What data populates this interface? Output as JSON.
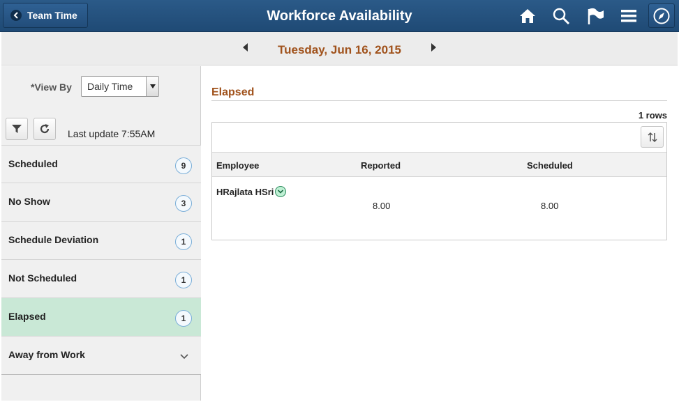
{
  "header": {
    "back_label": "Team Time",
    "title": "Workforce Availability",
    "icons": [
      "home-icon",
      "search-icon",
      "flag-icon",
      "menu-icon",
      "navbar-icon"
    ]
  },
  "datebar": {
    "date": "Tuesday, Jun 16, 2015"
  },
  "sidebar": {
    "view_by_label": "*View By",
    "view_by_value": "Daily Time",
    "last_update": "Last update 7:55AM",
    "items": [
      {
        "label": "Scheduled",
        "count": "9"
      },
      {
        "label": "No Show",
        "count": "3"
      },
      {
        "label": "Schedule Deviation",
        "count": "1"
      },
      {
        "label": "Not Scheduled",
        "count": "1"
      },
      {
        "label": "Elapsed",
        "count": "1",
        "selected": true
      },
      {
        "label": "Away from Work",
        "count": ""
      }
    ]
  },
  "main": {
    "section_title": "Elapsed",
    "rows_count": "1 rows",
    "columns": [
      "Employee",
      "Reported",
      "Scheduled"
    ],
    "rows": [
      {
        "employee": "HRajlata HSri",
        "reported": "8.00",
        "scheduled": "8.00"
      }
    ]
  },
  "colors": {
    "header_bg": "#1f4a75",
    "accent_orange": "#a0521c",
    "selected_row": "#c9e8d6"
  }
}
